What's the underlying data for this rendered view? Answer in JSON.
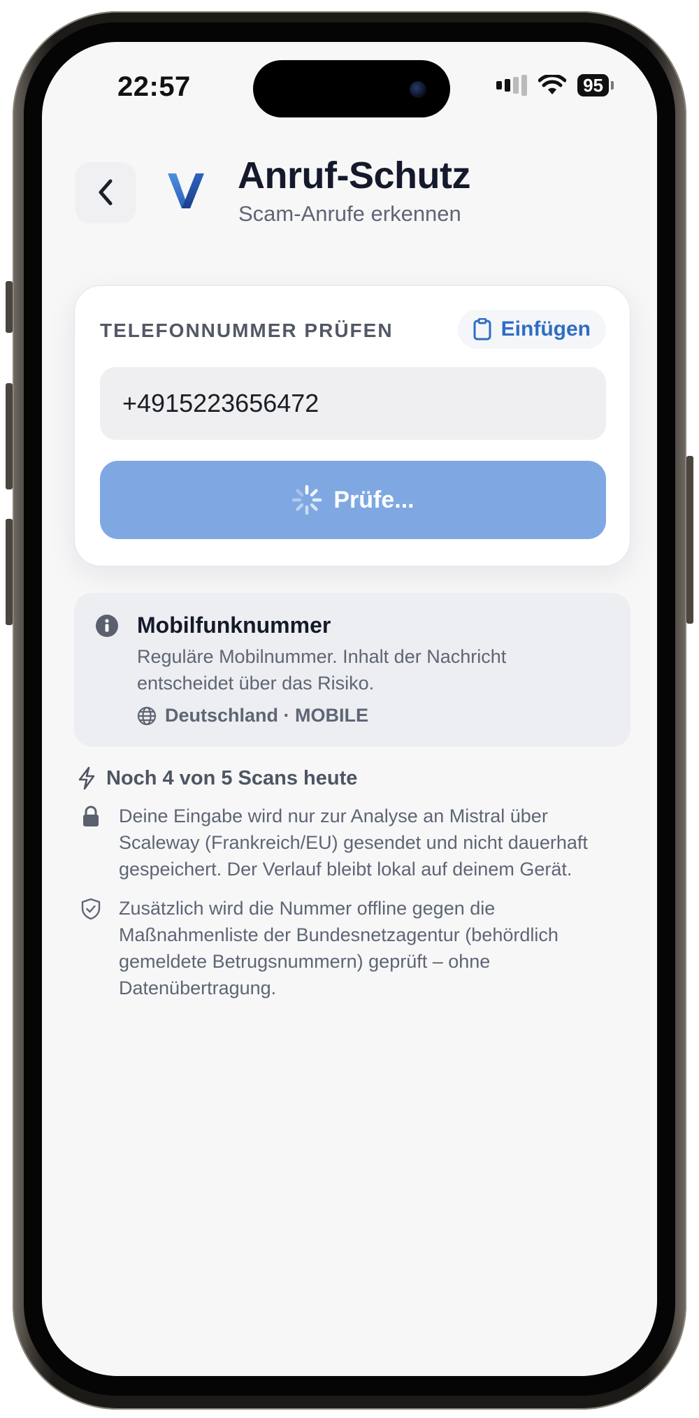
{
  "status_bar": {
    "time": "22:57",
    "battery": "95"
  },
  "header": {
    "title": "Anruf-Schutz",
    "subtitle": "Scam-Anrufe erkennen"
  },
  "check_card": {
    "label": "TELEFONNUMMER PRÜFEN",
    "paste_label": "Einfügen",
    "phone_value": "+4915223656472",
    "button_label": "Prüfe...",
    "button_state": "loading"
  },
  "info": {
    "title": "Mobilfunknummer",
    "description": "Reguläre Mobilnummer. Inhalt der Nachricht entscheidet über das Risiko.",
    "meta": "Deutschland · MOBILE"
  },
  "notes": {
    "scan_count": "Noch 4 von 5 Scans heute",
    "privacy": "Deine Eingabe wird nur zur Analyse an Mistral über Scaleway (Frankreich/EU) gesendet und nicht dauerhaft gespeichert. Der Verlauf bleibt lokal auf deinem Gerät.",
    "offline_check": "Zusätzlich wird die Nummer offline gegen die Maßnahmenliste der Bundesnetzagentur (behördlich gemeldete Betrugsnummern) geprüft – ohne Datenübertragung."
  },
  "colors": {
    "accent": "#2f6dc3",
    "button_disabled": "#7fa8e2",
    "title": "#141a2a",
    "muted": "#5e6574"
  },
  "icons": {
    "back": "chevron-left-icon",
    "logo": "app-logo-v",
    "paste": "clipboard-icon",
    "spinner": "spinner-icon",
    "info": "info-icon",
    "globe": "globe-icon",
    "bolt": "bolt-icon",
    "lock": "lock-icon",
    "shield": "shield-check-icon"
  }
}
